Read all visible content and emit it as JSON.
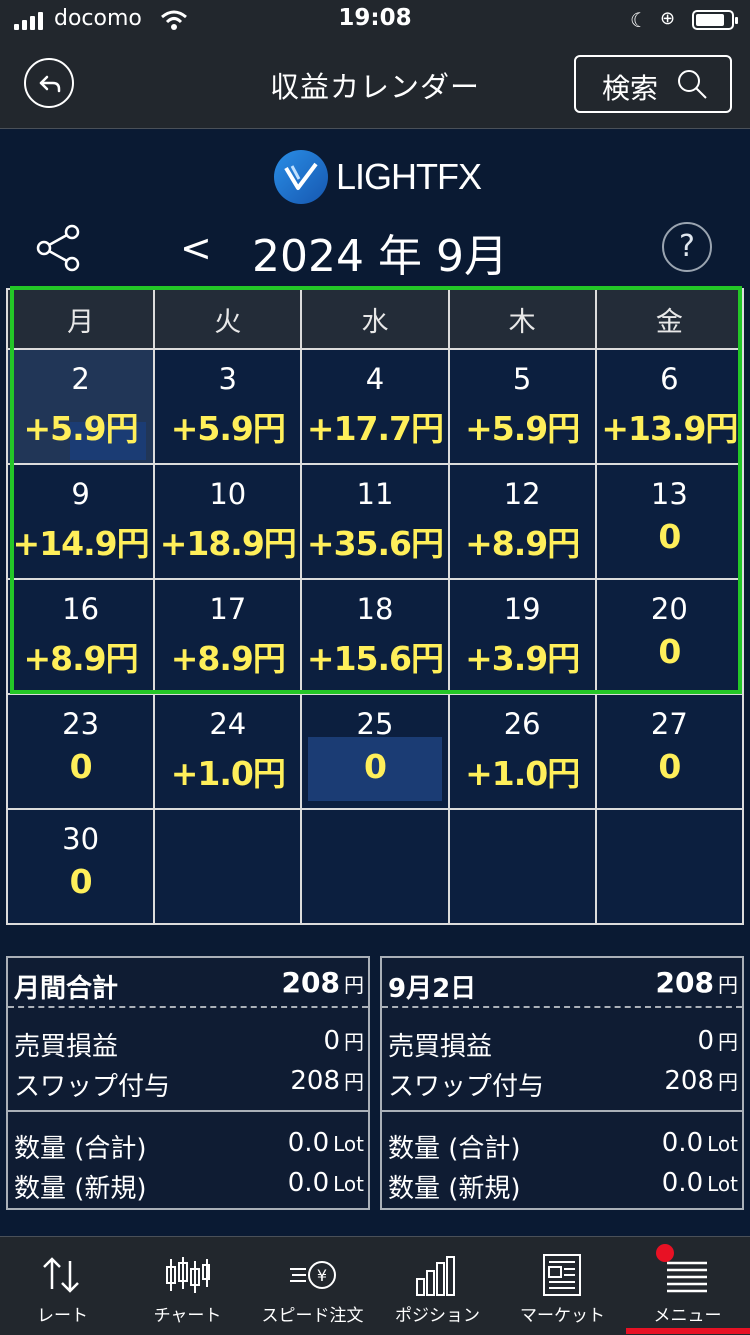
{
  "status_bar": {
    "carrier": "docomo",
    "time": "19:08"
  },
  "header": {
    "title": "収益カレンダー",
    "search_label": "検索"
  },
  "logo": {
    "text": "LIGHTFX"
  },
  "calendar": {
    "prev_label": "<",
    "month_title": "2024 年 9月",
    "help_label": "?",
    "weekdays": [
      "月",
      "火",
      "水",
      "木",
      "金"
    ],
    "weeks": [
      [
        {
          "day": "2",
          "amount": "+5.9円"
        },
        {
          "day": "3",
          "amount": "+5.9円"
        },
        {
          "day": "4",
          "amount": "+17.7円"
        },
        {
          "day": "5",
          "amount": "+5.9円"
        },
        {
          "day": "6",
          "amount": "+13.9円"
        }
      ],
      [
        {
          "day": "9",
          "amount": "+14.9円"
        },
        {
          "day": "10",
          "amount": "+18.9円"
        },
        {
          "day": "11",
          "amount": "+35.6円"
        },
        {
          "day": "12",
          "amount": "+8.9円"
        },
        {
          "day": "13",
          "amount": "0"
        }
      ],
      [
        {
          "day": "16",
          "amount": "+8.9円"
        },
        {
          "day": "17",
          "amount": "+8.9円"
        },
        {
          "day": "18",
          "amount": "+15.6円"
        },
        {
          "day": "19",
          "amount": "+3.9円"
        },
        {
          "day": "20",
          "amount": "0"
        }
      ],
      [
        {
          "day": "23",
          "amount": "0"
        },
        {
          "day": "24",
          "amount": "+1.0円"
        },
        {
          "day": "25",
          "amount": "0"
        },
        {
          "day": "26",
          "amount": "+1.0円"
        },
        {
          "day": "27",
          "amount": "0"
        }
      ],
      [
        {
          "day": "30",
          "amount": "0"
        },
        {
          "day": "",
          "amount": ""
        },
        {
          "day": "",
          "amount": ""
        },
        {
          "day": "",
          "amount": ""
        },
        {
          "day": "",
          "amount": ""
        }
      ]
    ]
  },
  "monthly_summary": {
    "title": "月間合計",
    "total": "208",
    "unit": "円",
    "trade_pl_label": "売買損益",
    "trade_pl": "0",
    "trade_pl_unit": "円",
    "swap_label": "スワップ付与",
    "swap": "208",
    "swap_unit": "円",
    "qty_total_label": "数量 (合計)",
    "qty_total": "0.0",
    "qty_total_unit": "Lot",
    "qty_new_label": "数量 (新規)",
    "qty_new": "0.0",
    "qty_new_unit": "Lot"
  },
  "daily_summary": {
    "title": "9月2日",
    "total": "208",
    "unit": "円",
    "trade_pl_label": "売買損益",
    "trade_pl": "0",
    "trade_pl_unit": "円",
    "swap_label": "スワップ付与",
    "swap": "208",
    "swap_unit": "円",
    "qty_total_label": "数量 (合計)",
    "qty_total": "0.0",
    "qty_total_unit": "Lot",
    "qty_new_label": "数量 (新規)",
    "qty_new": "0.0",
    "qty_new_unit": "Lot"
  },
  "tabs": [
    {
      "label": "レート",
      "icon": "rate-arrows-icon"
    },
    {
      "label": "チャート",
      "icon": "candlestick-icon"
    },
    {
      "label": "スピード注文",
      "icon": "speed-order-icon"
    },
    {
      "label": "ポジション",
      "icon": "bar-chart-icon"
    },
    {
      "label": "マーケット",
      "icon": "newspaper-icon"
    },
    {
      "label": "メニュー",
      "icon": "menu-icon"
    }
  ],
  "colors": {
    "accent_yellow": "#ffef5a",
    "frame_green": "#24c727",
    "badge_red": "#e81124",
    "background": "#0a1a33"
  }
}
